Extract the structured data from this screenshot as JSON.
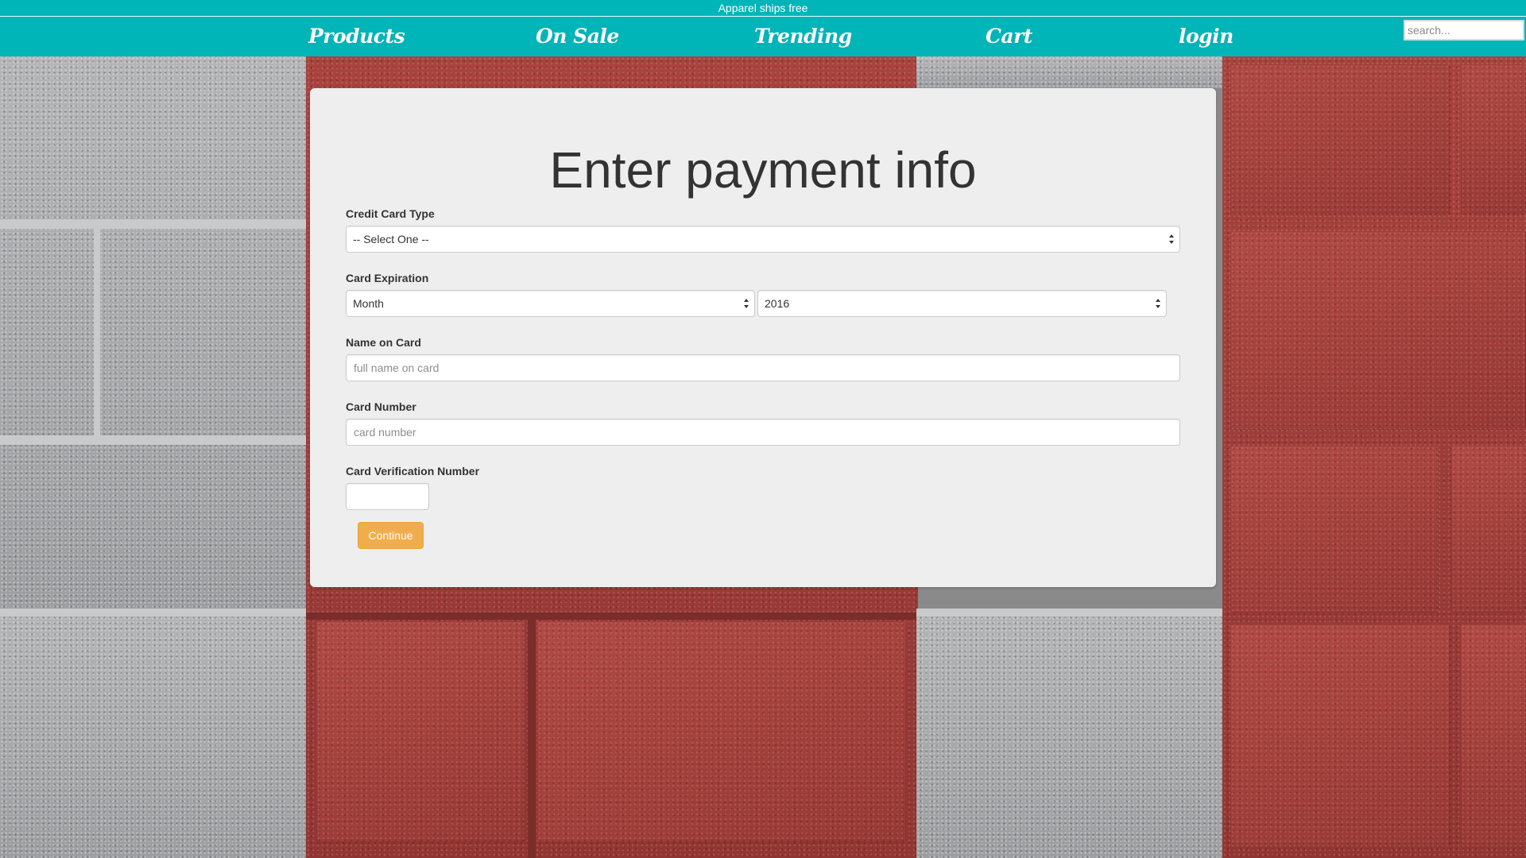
{
  "announcement": "Apparel ships free",
  "nav": {
    "items": [
      {
        "label": "Products"
      },
      {
        "label": "On Sale"
      },
      {
        "label": "Trending"
      },
      {
        "label": "Cart"
      },
      {
        "label": "login"
      }
    ],
    "search_placeholder": "search..."
  },
  "form": {
    "title": "Enter payment info",
    "card_type": {
      "label": "Credit Card Type",
      "value": "-- Select One --"
    },
    "expiration": {
      "label": "Card Expiration",
      "month_value": "Month",
      "year_value": "2016"
    },
    "name": {
      "label": "Name on Card",
      "placeholder": "full name on card"
    },
    "number": {
      "label": "Card Number",
      "placeholder": "card number"
    },
    "cvv": {
      "label": "Card Verification Number",
      "value": ""
    },
    "continue_label": "Continue"
  },
  "colors": {
    "header": "#00b5b8",
    "panel": "#eeeeee",
    "button": "#f0ad4e"
  }
}
